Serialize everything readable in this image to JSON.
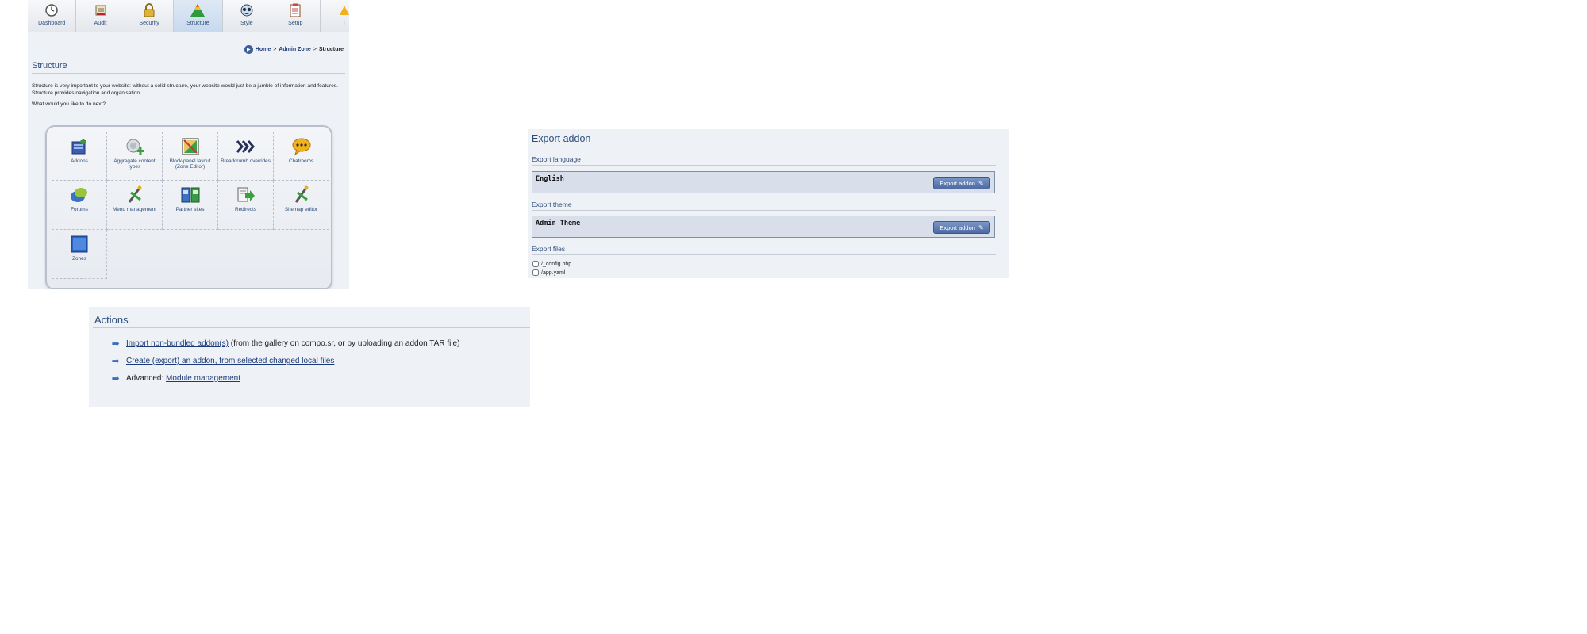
{
  "structure_screen": {
    "tabs": [
      {
        "label": "Dashboard",
        "icon": "clock-icon"
      },
      {
        "label": "Audit",
        "icon": "audit-icon"
      },
      {
        "label": "Security",
        "icon": "lock-icon"
      },
      {
        "label": "Structure",
        "icon": "pyramid-icon",
        "active": true
      },
      {
        "label": "Style",
        "icon": "glasses-icon"
      },
      {
        "label": "Setup",
        "icon": "clipboard-icon"
      },
      {
        "label": "T",
        "icon": "tools-icon"
      }
    ],
    "breadcrumb": {
      "home": "Home",
      "sep1": ">",
      "admin_zone": "Admin Zone",
      "sep2": ">",
      "current": "Structure"
    },
    "title": "Structure",
    "description": "Structure is very important to your website: without a solid structure, your website would just be a jumble of information and features. Structure provides navigation and organisation.",
    "prompt": "What would you like to do next?",
    "items": [
      {
        "label": "Addons",
        "icon": "addons-icon"
      },
      {
        "label": "Aggregate content types",
        "icon": "aggregate-icon"
      },
      {
        "label": "Block/panel layout (Zone Editor)",
        "icon": "zone-editor-icon"
      },
      {
        "label": "Breadcrumb overrides",
        "icon": "breadcrumb-icon"
      },
      {
        "label": "Chatrooms",
        "icon": "chat-icon"
      },
      {
        "label": "Forums",
        "icon": "forums-icon"
      },
      {
        "label": "Menu management",
        "icon": "menu-management-icon"
      },
      {
        "label": "Partner sites",
        "icon": "partner-sites-icon"
      },
      {
        "label": "Redirects",
        "icon": "redirects-icon"
      },
      {
        "label": "Sitemap editor",
        "icon": "sitemap-icon"
      },
      {
        "label": "Zones",
        "icon": "zones-icon"
      }
    ]
  },
  "export_addon": {
    "title": "Export addon",
    "sections": {
      "language": {
        "heading": "Export language",
        "value": "English",
        "button": "Export addon"
      },
      "theme": {
        "heading": "Export theme",
        "value": "Admin Theme",
        "button": "Export addon"
      },
      "files": {
        "heading": "Export files",
        "items": [
          "/_config.php",
          "/app.yaml"
        ]
      }
    }
  },
  "actions": {
    "title": "Actions",
    "items": [
      {
        "link": "Import non-bundled addon(s)",
        "suffix": " (from the gallery on compo.sr, or by uploading an addon TAR file)"
      },
      {
        "link": "Create (export) an addon, from selected changed local files"
      },
      {
        "prefix": "Advanced: ",
        "link": "Module management"
      }
    ]
  },
  "colors": {
    "accent": "#2d4d79",
    "panel_bg": "#eef1f6",
    "link": "#1a3a7a"
  }
}
